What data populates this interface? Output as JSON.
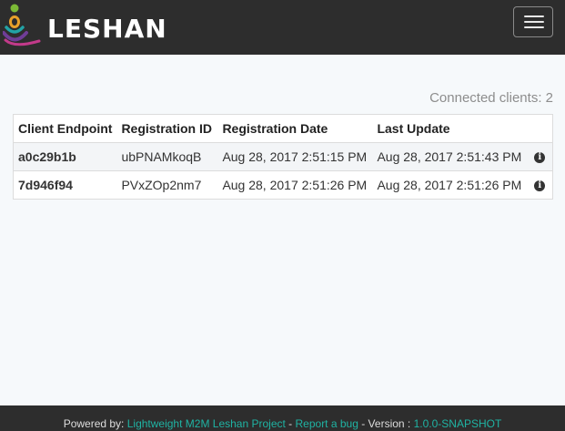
{
  "navbar": {
    "brand": "LESHAN",
    "logo_icon": "leshan-logo-icon",
    "menu_icon": "hamburger-menu-icon"
  },
  "status": {
    "connected_clients": "Connected clients: 2"
  },
  "table": {
    "headers": [
      "Client Endpoint",
      "Registration ID",
      "Registration Date",
      "Last Update"
    ],
    "rows": [
      {
        "endpoint": "a0c29b1b",
        "registration_id": "ubPNAMkoqB",
        "registration_date": "Aug 28, 2017 2:51:15 PM",
        "last_update": "Aug 28, 2017 2:51:43 PM",
        "info": "i"
      },
      {
        "endpoint": "7d946f94",
        "registration_id": "PVxZOp2nm7",
        "registration_date": "Aug 28, 2017 2:51:26 PM",
        "last_update": "Aug 28, 2017 2:51:26 PM",
        "info": "i"
      }
    ]
  },
  "footer": {
    "powered_by": "Powered by:",
    "project_link": "Lightweight M2M Leshan Project",
    "sep1": " - ",
    "bug_link": "Report a bug",
    "sep2": " - Version : ",
    "version": "1.0.0-SNAPSHOT"
  },
  "colors": {
    "navbar_bg": "#2d2d2d",
    "accent": "#1a9c8e",
    "logo_green": "#7bb936",
    "logo_orange": "#e8a12a",
    "logo_purple": "#6f3d97",
    "logo_teal": "#22a3a6"
  }
}
